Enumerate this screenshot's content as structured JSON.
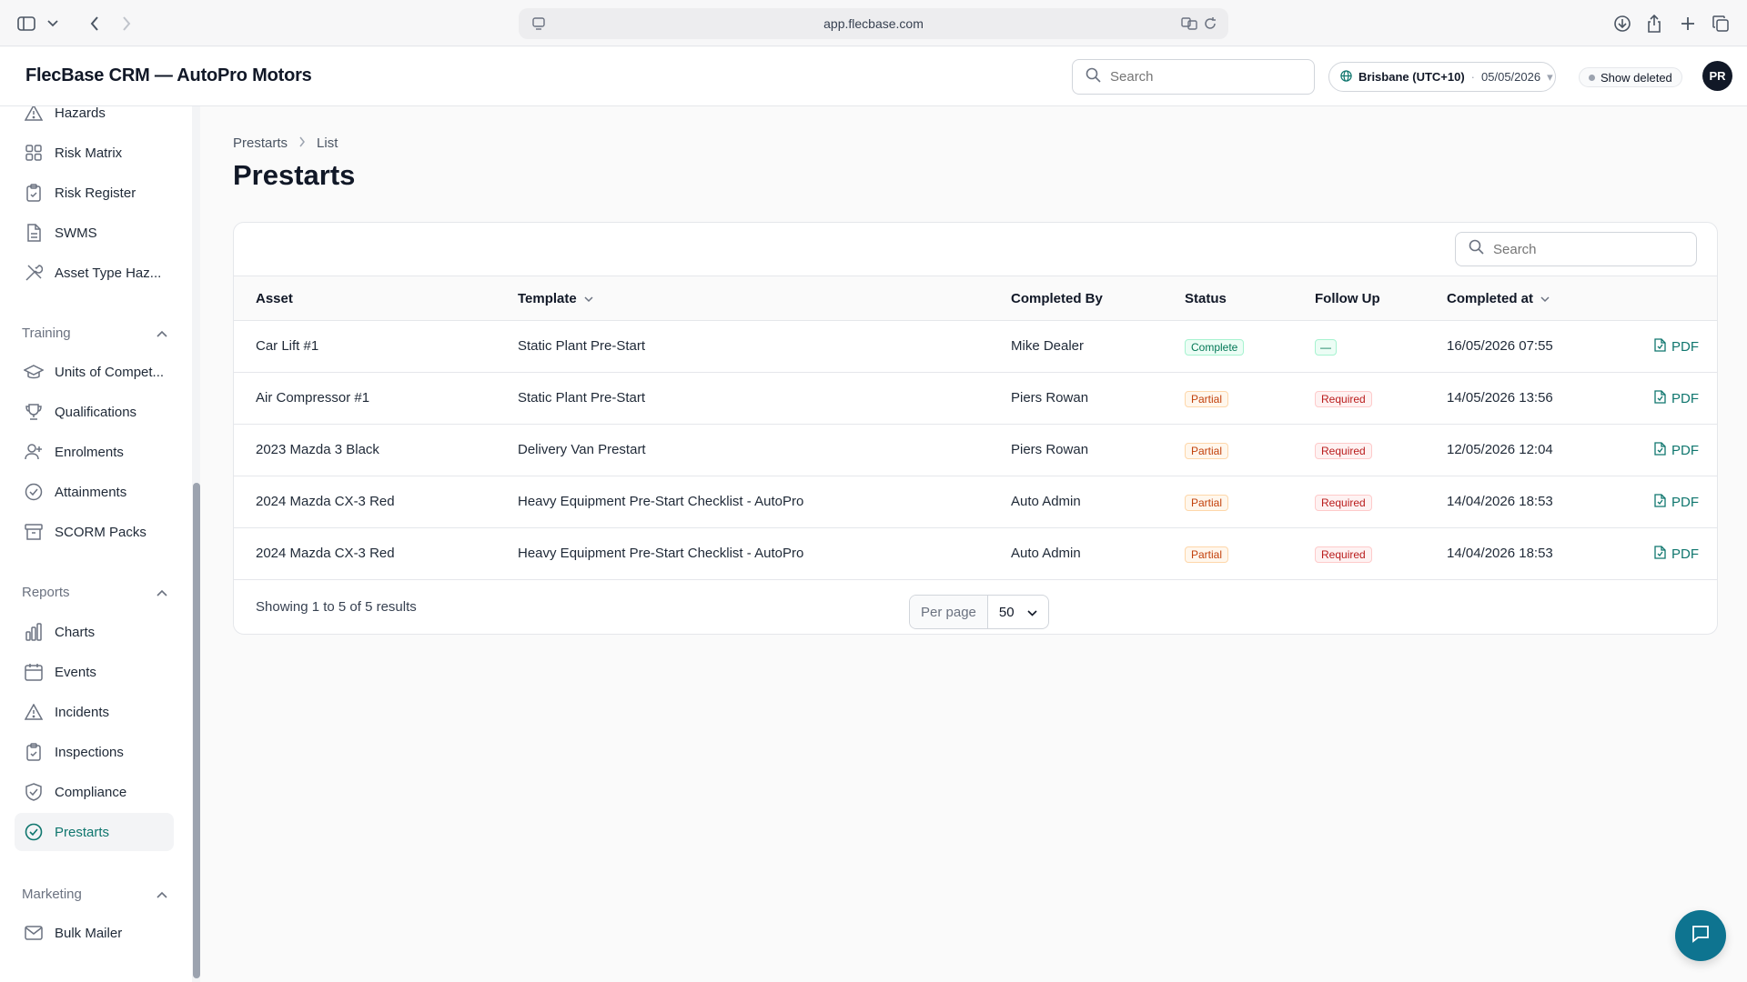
{
  "browser": {
    "url": "app.flecbase.com"
  },
  "header": {
    "app_title": "FlecBase CRM — AutoPro Motors",
    "search_placeholder": "Search",
    "timezone": "Brisbane (UTC+10)",
    "date": "05/05/2026",
    "show_deleted_label": "Show deleted",
    "avatar_initials": "PR"
  },
  "sidebar": {
    "items_top": [
      {
        "label": "Hazards",
        "icon": "warning-icon"
      },
      {
        "label": "Risk Matrix",
        "icon": "grid-icon"
      },
      {
        "label": "Risk Register",
        "icon": "clipboard-icon"
      },
      {
        "label": "SWMS",
        "icon": "document-icon"
      },
      {
        "label": "Asset Type Haz...",
        "icon": "tools-icon"
      }
    ],
    "groups": [
      {
        "label": "Training",
        "items": [
          {
            "label": "Units of Compet...",
            "icon": "graduation-cap-icon"
          },
          {
            "label": "Qualifications",
            "icon": "trophy-icon"
          },
          {
            "label": "Enrolments",
            "icon": "user-plus-icon"
          },
          {
            "label": "Attainments",
            "icon": "check-circle-icon"
          },
          {
            "label": "SCORM Packs",
            "icon": "archive-icon"
          }
        ]
      },
      {
        "label": "Reports",
        "items": [
          {
            "label": "Charts",
            "icon": "bar-chart-icon"
          },
          {
            "label": "Events",
            "icon": "calendar-icon"
          },
          {
            "label": "Incidents",
            "icon": "warning-icon"
          },
          {
            "label": "Inspections",
            "icon": "clipboard-check-icon"
          },
          {
            "label": "Compliance",
            "icon": "shield-check-icon"
          },
          {
            "label": "Prestarts",
            "icon": "check-circle-icon"
          }
        ]
      },
      {
        "label": "Marketing",
        "items": [
          {
            "label": "Bulk Mailer",
            "icon": "envelope-icon"
          }
        ]
      }
    ],
    "active": "Prestarts"
  },
  "page": {
    "breadcrumb": [
      "Prestarts",
      "List"
    ],
    "title": "Prestarts"
  },
  "table": {
    "search_placeholder": "Search",
    "columns": [
      "Asset",
      "Template",
      "Completed By",
      "Status",
      "Follow Up",
      "Completed at"
    ],
    "rows": [
      {
        "asset": "Car Lift #1",
        "template": "Static Plant Pre-Start",
        "completed_by": "Mike Dealer",
        "status": "Complete",
        "follow_up": "—",
        "completed_at": "16/05/2026 07:55",
        "action": "PDF"
      },
      {
        "asset": "Air Compressor #1",
        "template": "Static Plant Pre-Start",
        "completed_by": "Piers Rowan",
        "status": "Partial",
        "follow_up": "Required",
        "completed_at": "14/05/2026 13:56",
        "action": "PDF"
      },
      {
        "asset": "2023 Mazda 3 Black",
        "template": "Delivery Van Prestart",
        "completed_by": "Piers Rowan",
        "status": "Partial",
        "follow_up": "Required",
        "completed_at": "12/05/2026 12:04",
        "action": "PDF"
      },
      {
        "asset": "2024 Mazda CX-3 Red",
        "template": "Heavy Equipment Pre-Start Checklist - AutoPro",
        "completed_by": "Auto Admin",
        "status": "Partial",
        "follow_up": "Required",
        "completed_at": "14/04/2026 18:53",
        "action": "PDF"
      },
      {
        "asset": "2024 Mazda CX-3 Red",
        "template": "Heavy Equipment Pre-Start Checklist - AutoPro",
        "completed_by": "Auto Admin",
        "status": "Partial",
        "follow_up": "Required",
        "completed_at": "14/04/2026 18:53",
        "action": "PDF"
      }
    ],
    "footer": {
      "showing": "Showing 1 to 5 of 5 results",
      "per_page_label": "Per page",
      "per_page_value": "50"
    }
  },
  "colors": {
    "accent": "#0f766e",
    "fab": "#0e7490"
  }
}
